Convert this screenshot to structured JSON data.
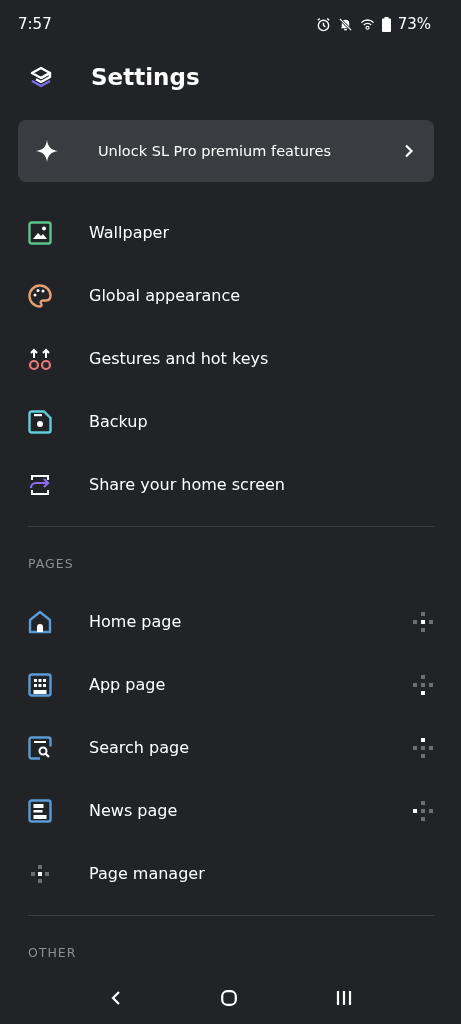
{
  "status_bar": {
    "time": "7:57",
    "battery": "73%"
  },
  "header": {
    "title": "Settings"
  },
  "promo": {
    "label": "Unlock SL Pro premium features"
  },
  "general_items": [
    {
      "kind": "wallpaper",
      "label": "Wallpaper"
    },
    {
      "kind": "palette",
      "label": "Global appearance"
    },
    {
      "kind": "gestures",
      "label": "Gestures and hot keys"
    },
    {
      "kind": "backup",
      "label": "Backup"
    },
    {
      "kind": "share",
      "label": "Share your home screen"
    }
  ],
  "pages_section": {
    "heading": "PAGES",
    "items": [
      {
        "kind": "home",
        "label": "Home page",
        "position_dots": [
          {
            "lit": false
          },
          {
            "lit": false
          },
          {
            "lit": true
          },
          {
            "lit": false
          },
          {
            "lit": false
          }
        ]
      },
      {
        "kind": "apps",
        "label": "App page",
        "position_dots": [
          {
            "lit": false
          },
          {
            "lit": false
          },
          {
            "lit": false
          },
          {
            "lit": false
          },
          {
            "lit": true
          }
        ]
      },
      {
        "kind": "search",
        "label": "Search page",
        "position_dots": [
          {
            "lit": true
          },
          {
            "lit": false
          },
          {
            "lit": false
          },
          {
            "lit": false
          },
          {
            "lit": false
          }
        ]
      },
      {
        "kind": "news",
        "label": "News page",
        "position_dots": [
          {
            "lit": false
          },
          {
            "lit": true
          },
          {
            "lit": false
          },
          {
            "lit": false
          },
          {
            "lit": false
          }
        ]
      },
      {
        "kind": "manager",
        "label": "Page manager"
      }
    ]
  },
  "other_section": {
    "heading": "OTHER"
  }
}
